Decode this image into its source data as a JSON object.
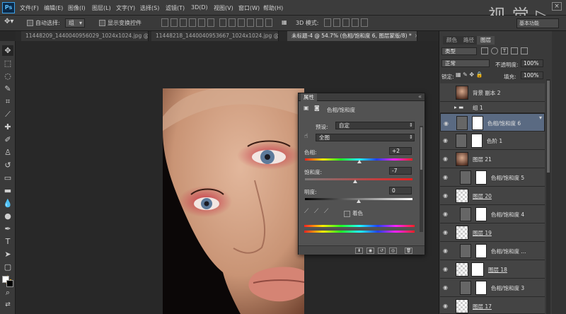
{
  "app": {
    "logo": "Ps",
    "watermark": "视 觉 ▷"
  },
  "menu": [
    "文件(F)",
    "编辑(E)",
    "图像(I)",
    "图层(L)",
    "文字(Y)",
    "选择(S)",
    "滤镜(T)",
    "3D(D)",
    "视图(V)",
    "窗口(W)",
    "帮助(H)"
  ],
  "options_bar": {
    "auto_select_label": "自动选择:",
    "auto_select_value": "组",
    "show_transform_label": "显示变换控件",
    "mode_3d_label": "3D 模式:",
    "workspace": "基本功能"
  },
  "tabs": [
    {
      "label": "11448209_1440040956029_1024x1024.jpg @ ...",
      "close": "×"
    },
    {
      "label": "11448218_1440040953667_1024x1024.jpg @ ...",
      "close": "×"
    },
    {
      "label": "未标题-4 @ 54.7% (色相/饱和度 6, 图层蒙版/8) *",
      "close": "×"
    }
  ],
  "properties": {
    "tab": "属性",
    "title": "色相/饱和度",
    "preset_label": "预设:",
    "preset_value": "自定",
    "channel_value": "全图",
    "hue_label": "色相:",
    "hue_value": "+2",
    "saturation_label": "饱和度:",
    "saturation_value": "-7",
    "lightness_label": "明度:",
    "lightness_value": "0",
    "colorize_label": "着色",
    "hue_min": -180,
    "hue_max": 180,
    "hue": 2,
    "saturation_min": -100,
    "saturation_max": 100,
    "saturation": -7,
    "lightness_min": -100,
    "lightness_max": 100,
    "lightness": 0
  },
  "right_panel": {
    "tabs": [
      "颜色",
      "路径",
      "图层"
    ],
    "kind_label": "类型",
    "blend_mode": "正常",
    "opacity_label": "不透明度:",
    "opacity_value": "100%",
    "lock_label": "锁定:",
    "fill_label": "填充:",
    "fill_value": "100%",
    "layers": [
      {
        "name": "背景 副本 2"
      },
      {
        "name": "组 1"
      },
      {
        "name": "色相/饱和度 6"
      },
      {
        "name": "色阶 1"
      },
      {
        "name": "图层 21"
      },
      {
        "name": "色相/饱和度 5"
      },
      {
        "name": "图层 20"
      },
      {
        "name": "色相/饱和度 4"
      },
      {
        "name": "图层 19"
      },
      {
        "name": "色相/饱和度 ..."
      },
      {
        "name": "图层 18"
      },
      {
        "name": "色相/饱和度 3"
      },
      {
        "name": "图层 17"
      }
    ]
  }
}
